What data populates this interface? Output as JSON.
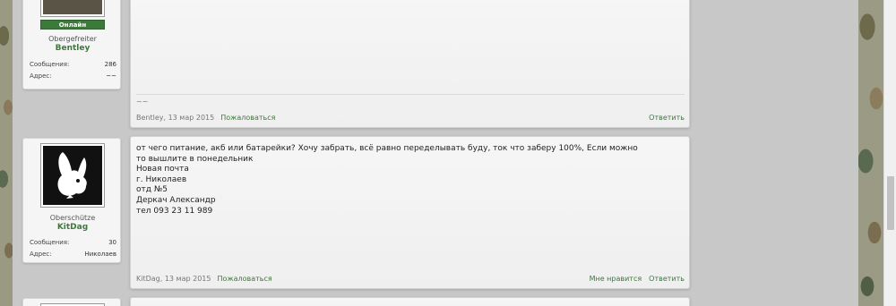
{
  "posts": [
    {
      "author": {
        "rank": "Obergefreiter",
        "username": "Bentley",
        "online_badge": "Онлайн",
        "stats": [
          {
            "label": "Сообщения:",
            "value": "286"
          },
          {
            "label": "Адрес:",
            "value": "~~"
          }
        ]
      },
      "signature": "~~",
      "footer": {
        "author_date": "Bentley, 13 мар 2015",
        "report": "Пожаловаться",
        "reply": "Ответить"
      }
    },
    {
      "author": {
        "rank": "Oberschütze",
        "username": "KitDag",
        "stats": [
          {
            "label": "Сообщения:",
            "value": "30"
          },
          {
            "label": "Адрес:",
            "value": "Николаев"
          }
        ]
      },
      "body_lines": [
        "от чего питание, акб или батарейки? Хочу забрать, всё равно переделывать буду, ток что заберу 100%, Если можно",
        "то вышлите в понедельник",
        "Новая почта",
        "г. Николаев",
        "отд №5",
        "Деркач Александр",
        "тел 093 23 11 989"
      ],
      "footer": {
        "author_date": "KitDag, 13 мар 2015",
        "report": "Пожаловаться",
        "like": "Мне нравится",
        "reply": "Ответить"
      }
    }
  ]
}
